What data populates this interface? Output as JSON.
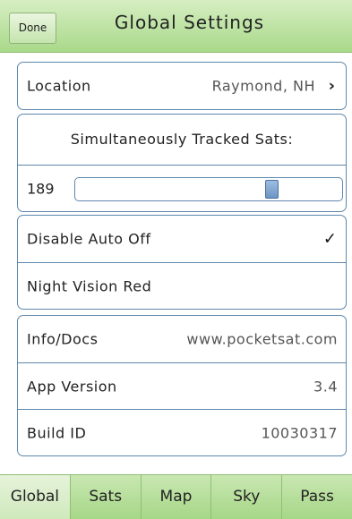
{
  "header": {
    "done_label": "Done",
    "title": "Global Settings"
  },
  "location": {
    "label": "Location",
    "value": "Raymond, NH",
    "chevron_icon": "chevron-right-icon"
  },
  "tracked_sats": {
    "label": "Simultaneously Tracked Sats:",
    "value": "189",
    "slider_fraction": 0.75
  },
  "toggles": [
    {
      "label": "Disable Auto Off",
      "checked": true,
      "check_icon": "checkmark-icon"
    },
    {
      "label": "Night Vision Red",
      "checked": false
    }
  ],
  "info": {
    "docs_label": "Info/Docs",
    "docs_value": "www.pocketsat.com",
    "version_label": "App Version",
    "version_value": "3.4",
    "build_label": "Build ID",
    "build_value": "10030317"
  },
  "tabs": [
    {
      "label": "Global",
      "active": true
    },
    {
      "label": "Sats",
      "active": false
    },
    {
      "label": "Map",
      "active": false
    },
    {
      "label": "Sky",
      "active": false
    },
    {
      "label": "Pass",
      "active": false
    }
  ],
  "colors": {
    "header_green": "#a9d98a",
    "border_blue": "#5e87ad",
    "thumb_blue": "#6e95c4"
  }
}
